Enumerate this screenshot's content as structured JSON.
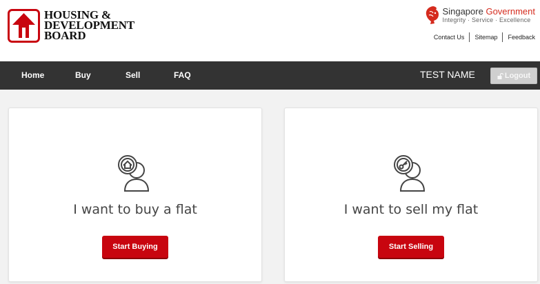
{
  "header": {
    "logo_lines": [
      "HOUSING &",
      "DEVELOPMENT",
      "BOARD"
    ],
    "gov_name_part1": "Singapore",
    "gov_name_part2": "Government",
    "gov_tagline": "Integrity · Service · Excellence",
    "links": [
      "Contact Us",
      "Sitemap",
      "Feedback"
    ]
  },
  "nav": {
    "items": [
      "Home",
      "Buy",
      "Sell",
      "FAQ"
    ],
    "user_name": "TEST NAME",
    "logout_label": "Logout"
  },
  "cards": [
    {
      "title": "I want to buy a flat",
      "button": "Start Buying",
      "icon": "house-user-icon"
    },
    {
      "title": "I want to sell my flat",
      "button": "Start Selling",
      "icon": "key-user-icon"
    }
  ],
  "colors": {
    "brand_red": "#c8050f",
    "nav_bg": "#333333",
    "gov_red": "#d52b1e"
  }
}
